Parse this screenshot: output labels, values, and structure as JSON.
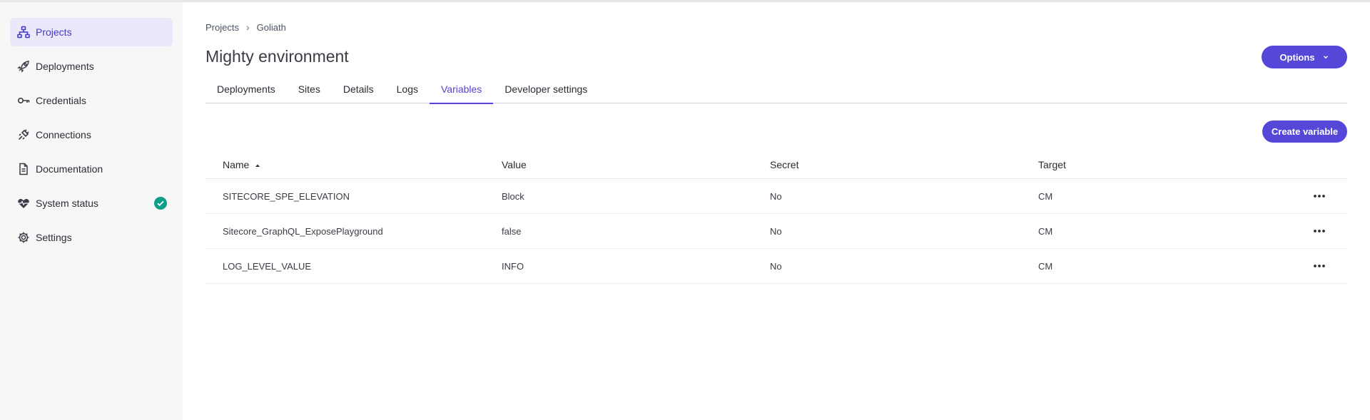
{
  "sidebar": {
    "items": [
      {
        "label": "Projects",
        "icon": "sitemap-icon"
      },
      {
        "label": "Deployments",
        "icon": "rocket-icon"
      },
      {
        "label": "Credentials",
        "icon": "key-icon"
      },
      {
        "label": "Connections",
        "icon": "plug-icon"
      },
      {
        "label": "Documentation",
        "icon": "document-icon"
      },
      {
        "label": "System status",
        "icon": "heartbeat-icon"
      },
      {
        "label": "Settings",
        "icon": "gear-icon"
      }
    ]
  },
  "breadcrumb": {
    "items": [
      "Projects",
      "Goliath"
    ],
    "separator": "›"
  },
  "page": {
    "title": "Mighty environment"
  },
  "header": {
    "options_label": "Options"
  },
  "tabs": [
    {
      "label": "Deployments"
    },
    {
      "label": "Sites"
    },
    {
      "label": "Details"
    },
    {
      "label": "Logs"
    },
    {
      "label": "Variables",
      "active": true
    },
    {
      "label": "Developer settings"
    }
  ],
  "toolbar": {
    "create_label": "Create variable"
  },
  "table": {
    "headers": {
      "name": "Name",
      "value": "Value",
      "secret": "Secret",
      "target": "Target"
    },
    "rows": [
      {
        "name": "SITECORE_SPE_ELEVATION",
        "value": "Block",
        "secret": "No",
        "target": "CM"
      },
      {
        "name": "Sitecore_GraphQL_ExposePlayground",
        "value": "false",
        "secret": "No",
        "target": "CM"
      },
      {
        "name": "LOG_LEVEL_VALUE",
        "value": "INFO",
        "secret": "No",
        "target": "CM"
      }
    ]
  },
  "colors": {
    "accent": "#5548d9",
    "active_tab": "#5b3fd6",
    "status_ok": "#0f9d8a",
    "sidebar_active_bg": "#ebe8fb"
  }
}
